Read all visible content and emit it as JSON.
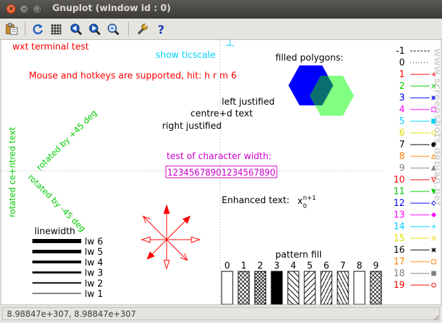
{
  "window": {
    "title": "Gnuplot (window id : 0)",
    "close_icon": "close-icon",
    "minimize_icon": "minimize-icon",
    "maximize_icon": "maximize-icon"
  },
  "toolbar": {
    "buttons": [
      {
        "name": "copy-to-clipboard-button",
        "icon": "clipboard-icon"
      },
      {
        "name": "replot-button",
        "icon": "refresh-icon"
      },
      {
        "name": "toggle-grid-button",
        "icon": "grid-icon"
      },
      {
        "name": "previous-zoom-button",
        "icon": "zoom-previous-icon"
      },
      {
        "name": "next-zoom-button",
        "icon": "zoom-next-icon"
      },
      {
        "name": "autoscale-button",
        "icon": "autoscale-icon"
      },
      {
        "name": "configure-button",
        "icon": "wrench-icon"
      },
      {
        "name": "help-button",
        "icon": "help-icon"
      }
    ]
  },
  "plot": {
    "title": "wxt  terminal test",
    "mouse_text": "Mouse and hotkeys are supported, hit: h r m 6",
    "show_ticscale": "show ticscale",
    "left_justified": "left justified",
    "centred": "centre+d text",
    "right_justified": "right justified",
    "rotated_centred": "rotated ce+ntred text",
    "rotated_plus45": "rotated by +45 deg",
    "rotated_minus45": "rotated by -45 deg",
    "char_width_title": "test of character width:",
    "char_width_sample": "12345678901234567890",
    "enhanced_label": "Enhanced text:",
    "enhanced_base": "x",
    "enhanced_sub": "0",
    "enhanced_sup": "n+1",
    "filled_polygons": "filled polygons:",
    "linewidth_title": "linewidth",
    "linewidths": [
      {
        "label": "lw 6",
        "width": 6
      },
      {
        "label": "lw 5",
        "width": 5
      },
      {
        "label": "lw 4",
        "width": 4
      },
      {
        "label": "lw 3",
        "width": 3
      },
      {
        "label": "lw 2",
        "width": 2
      },
      {
        "label": "lw 1",
        "width": 1
      }
    ],
    "pattern_title": "pattern fill",
    "patterns": [
      "0",
      "1",
      "2",
      "3",
      "4",
      "5",
      "6",
      "7",
      "8",
      "9"
    ],
    "keys": [
      {
        "label": "-1",
        "color": "#000000"
      },
      {
        "label": "0",
        "color": "#000000"
      },
      {
        "label": "1",
        "color": "#ff0000"
      },
      {
        "label": "2",
        "color": "#00cc00"
      },
      {
        "label": "3",
        "color": "#0000ff"
      },
      {
        "label": "4",
        "color": "#ff00ff"
      },
      {
        "label": "5",
        "color": "#00d0ff"
      },
      {
        "label": "6",
        "color": "#e0e000"
      },
      {
        "label": "7",
        "color": "#000000"
      },
      {
        "label": "8",
        "color": "#ff8000"
      },
      {
        "label": "9",
        "color": "#808080"
      },
      {
        "label": "10",
        "color": "#ff0000"
      },
      {
        "label": "11",
        "color": "#00cc00"
      },
      {
        "label": "12",
        "color": "#0000ff"
      },
      {
        "label": "13",
        "color": "#ff00ff"
      },
      {
        "label": "14",
        "color": "#00d0ff"
      },
      {
        "label": "15",
        "color": "#e0e000"
      },
      {
        "label": "16",
        "color": "#000000"
      },
      {
        "label": "17",
        "color": "#ff8000"
      },
      {
        "label": "18",
        "color": "#808080"
      },
      {
        "label": "19",
        "color": "#ff0000"
      }
    ],
    "watermark": "www.screenshots.debian.net",
    "colors": {
      "red": "#ff0000",
      "green": "#00cc00",
      "cyan": "#00d0ff",
      "magenta": "#cc00cc",
      "blue_polygon": "#0000ff",
      "green_polygon": "#80ff80",
      "teal_overlap": "#0b6f6f"
    }
  },
  "status": {
    "coordinates": "8.98847e+307,  8.98847e+307"
  }
}
